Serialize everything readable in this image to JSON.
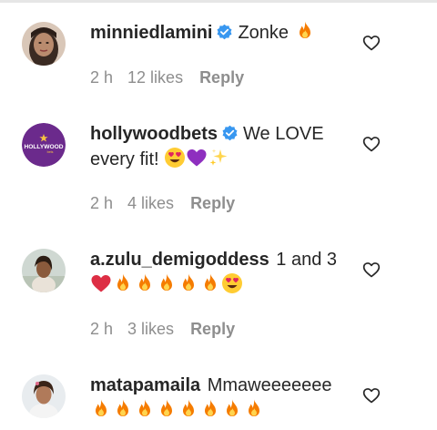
{
  "comments": [
    {
      "username": "minniedlamini",
      "verified": true,
      "text": "Zonke",
      "emoji": [
        "fire"
      ],
      "time": "2 h",
      "likes": "12 likes",
      "reply": "Reply"
    },
    {
      "username": "hollywoodbets",
      "verified": true,
      "text": "We LOVE every fit!",
      "emoji": [
        "heart-eyes",
        "purple-heart",
        "sparkles"
      ],
      "time": "2 h",
      "likes": "4 likes",
      "reply": "Reply",
      "avatar_logo_text": "HOLLYWOOD"
    },
    {
      "username": "a.zulu_demigoddess",
      "verified": false,
      "text": "1 and 3",
      "emoji": [
        "red-heart",
        "fire",
        "fire",
        "fire",
        "fire",
        "fire",
        "heart-eyes"
      ],
      "time": "2 h",
      "likes": "3 likes",
      "reply": "Reply"
    },
    {
      "username": "matapamaila",
      "verified": false,
      "text": "Mmaweeeeeee",
      "emoji": [
        "fire",
        "fire",
        "fire",
        "fire",
        "fire",
        "fire",
        "fire",
        "fire"
      ]
    }
  ],
  "colors": {
    "verified_blue": "#3897f0",
    "meta_gray": "#8e8e8e",
    "text": "#262626",
    "hollywood_purple": "#6b2a8c"
  }
}
